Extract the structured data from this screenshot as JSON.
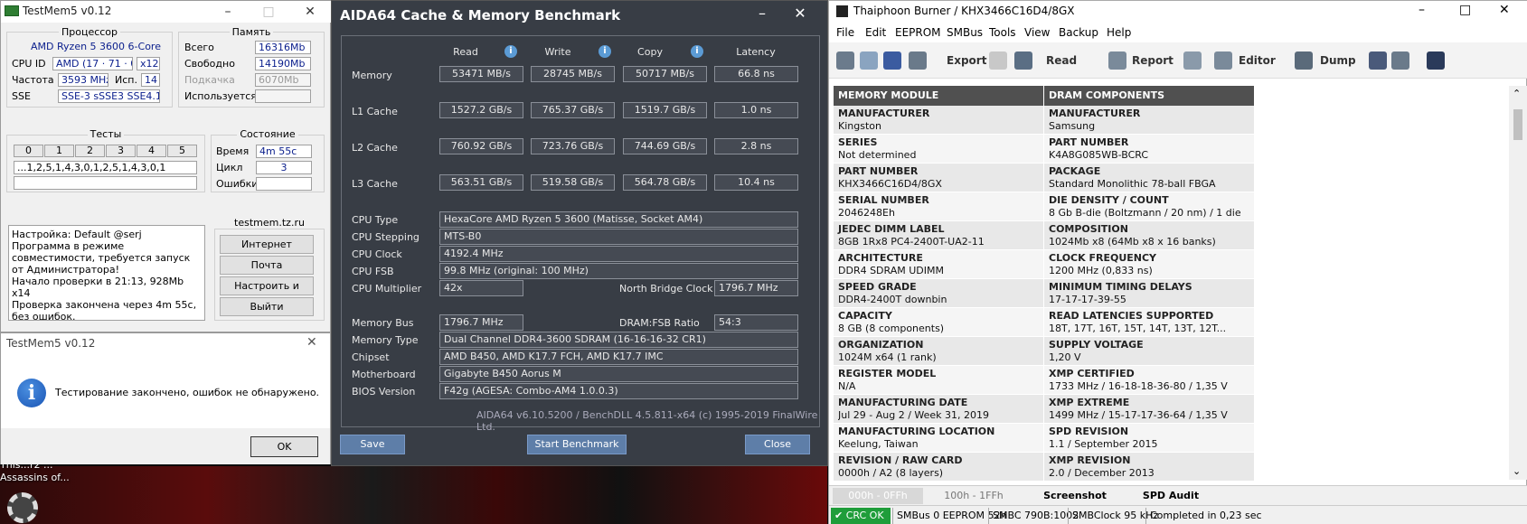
{
  "desktop": {
    "text_line1": "This...r2 ...",
    "text_line2": "Assassins of..."
  },
  "testmem": {
    "title": "TestMem5 v0.12",
    "cpu_group": "Процессор",
    "cpu_name": "AMD Ryzen 5 3600 6-Core",
    "cpu_id_label": "CPU ID",
    "cpu_id_value": "AMD  (17 · 71 · 0)",
    "cpu_threads": "x12",
    "freq_label": "Частота",
    "freq_value": "3593 MHz",
    "used_label": "Исп.",
    "used_value": "14",
    "sse_label": "SSE",
    "sse_value": "SSE-3 sSSE3 SSE4.1",
    "mem_group": "Память",
    "total_label": "Всего",
    "total_value": "16316Mb",
    "free_label": "Свободно",
    "free_value": "14190Mb",
    "swap_label": "Подкачка",
    "swap_value": "6070Mb",
    "inuse_label": "Используется",
    "inuse_value": "",
    "tests_group": "Тесты",
    "test_cells": [
      "0",
      "1",
      "2",
      "3",
      "4",
      "5"
    ],
    "test_sequence": "...1,2,5,1,4,3,0,1,2,5,1,4,3,0,1",
    "state_group": "Состояние",
    "time_label": "Время",
    "time_value": "4m 55c",
    "cycle_label": "Цикл",
    "cycle_value": "3",
    "errors_label": "Ошибки",
    "errors_value": "",
    "log_text": "Настройка: Default @serj\nПрограмма в режиме совместимости, требуется запуск от Администратора!\nНачало проверки в 21:13, 928Mb x14\nПроверка закончена через 4m 55c,\nбез ошибок.",
    "site_group": "testmem.tz.ru",
    "btn_internet": "Интернет",
    "btn_mail": "Почта",
    "btn_config": "Настроить и выйти",
    "btn_exit": "Выйти"
  },
  "dialog": {
    "title": "TestMem5 v0.12",
    "message": "Тестирование закончено, ошибок не обнаружено.",
    "ok_label": "OK"
  },
  "aida": {
    "title": "AIDA64 Cache & Memory Benchmark",
    "headers": {
      "read": "Read",
      "write": "Write",
      "copy": "Copy",
      "latency": "Latency"
    },
    "rows": [
      {
        "label": "Memory",
        "read": "53471 MB/s",
        "write": "28745 MB/s",
        "copy": "50717 MB/s",
        "latency": "66.8 ns"
      },
      {
        "label": "L1 Cache",
        "read": "1527.2 GB/s",
        "write": "765.37 GB/s",
        "copy": "1519.7 GB/s",
        "latency": "1.0 ns"
      },
      {
        "label": "L2 Cache",
        "read": "760.92 GB/s",
        "write": "723.76 GB/s",
        "copy": "744.69 GB/s",
        "latency": "2.8 ns"
      },
      {
        "label": "L3 Cache",
        "read": "563.51 GB/s",
        "write": "519.58 GB/s",
        "copy": "564.78 GB/s",
        "latency": "10.4 ns"
      }
    ],
    "cpu_type_label": "CPU Type",
    "cpu_type": "HexaCore AMD Ryzen 5 3600  (Matisse, Socket AM4)",
    "cpu_stepping_label": "CPU Stepping",
    "cpu_stepping": "MTS-B0",
    "cpu_clock_label": "CPU Clock",
    "cpu_clock": "4192.4 MHz",
    "cpu_fsb_label": "CPU FSB",
    "cpu_fsb": "99.8 MHz  (original: 100 MHz)",
    "cpu_mult_label": "CPU Multiplier",
    "cpu_mult": "42x",
    "nb_clock_label": "North Bridge Clock",
    "nb_clock": "1796.7 MHz",
    "mem_bus_label": "Memory Bus",
    "mem_bus": "1796.7 MHz",
    "dram_ratio_label": "DRAM:FSB Ratio",
    "dram_ratio": "54:3",
    "mem_type_label": "Memory Type",
    "mem_type": "Dual Channel DDR4-3600 SDRAM  (16-16-16-32 CR1)",
    "chipset_label": "Chipset",
    "chipset": "AMD B450, AMD K17.7 FCH, AMD K17.7 IMC",
    "mobo_label": "Motherboard",
    "mobo": "Gigabyte B450 Aorus M",
    "bios_label": "BIOS Version",
    "bios": "F42g  (AGESA: Combo-AM4 1.0.0.3)",
    "footer": "AIDA64 v6.10.5200 / BenchDLL 4.5.811-x64  (c) 1995-2019 FinalWire Ltd.",
    "btn_save": "Save",
    "btn_start": "Start Benchmark",
    "btn_close": "Close"
  },
  "thai": {
    "title": "Thaiphoon Burner / KHX3466C16D4/8GX",
    "menu": [
      "File",
      "Edit",
      "EEPROM",
      "SMBus",
      "Tools",
      "View",
      "Backup",
      "Help"
    ],
    "toolbar": {
      "export": "Export",
      "read": "Read",
      "report": "Report",
      "editor": "Editor",
      "dump": "Dump"
    },
    "left_header": "MEMORY MODULE",
    "right_header": "DRAM COMPONENTS",
    "left": [
      {
        "k": "MANUFACTURER",
        "v": "Kingston"
      },
      {
        "k": "SERIES",
        "v": "Not determined"
      },
      {
        "k": "PART NUMBER",
        "v": "KHX3466C16D4/8GX"
      },
      {
        "k": "SERIAL NUMBER",
        "v": "2046248Eh"
      },
      {
        "k": "JEDEC DIMM LABEL",
        "v": "8GB 1Rx8 PC4-2400T-UA2-11"
      },
      {
        "k": "ARCHITECTURE",
        "v": "DDR4 SDRAM UDIMM"
      },
      {
        "k": "SPEED GRADE",
        "v": "DDR4-2400T downbin"
      },
      {
        "k": "CAPACITY",
        "v": "8 GB (8 components)"
      },
      {
        "k": "ORGANIZATION",
        "v": "1024M x64 (1 rank)"
      },
      {
        "k": "REGISTER MODEL",
        "v": "N/A"
      },
      {
        "k": "MANUFACTURING DATE",
        "v": "Jul 29 - Aug 2 / Week 31, 2019"
      },
      {
        "k": "MANUFACTURING LOCATION",
        "v": "Keelung, Taiwan"
      },
      {
        "k": "REVISION / RAW CARD",
        "v": "0000h / A2 (8 layers)"
      }
    ],
    "right": [
      {
        "k": "MANUFACTURER",
        "v": "Samsung"
      },
      {
        "k": "PART NUMBER",
        "v": "K4A8G085WB-BCRC"
      },
      {
        "k": "PACKAGE",
        "v": "Standard Monolithic 78-ball FBGA"
      },
      {
        "k": "DIE DENSITY / COUNT",
        "v": "8 Gb B-die (Boltzmann / 20 nm) / 1 die"
      },
      {
        "k": "COMPOSITION",
        "v": "1024Mb x8 (64Mb x8 x 16 banks)"
      },
      {
        "k": "CLOCK FREQUENCY",
        "v": "1200 MHz (0,833 ns)"
      },
      {
        "k": "MINIMUM TIMING DELAYS",
        "v": "17-17-17-39-55"
      },
      {
        "k": "READ LATENCIES SUPPORTED",
        "v": "18T, 17T, 16T, 15T, 14T, 13T, 12T..."
      },
      {
        "k": "SUPPLY VOLTAGE",
        "v": "1,20 V"
      },
      {
        "k": "XMP CERTIFIED",
        "v": "1733 MHz / 16-18-18-36-80 / 1,35 V"
      },
      {
        "k": "XMP EXTREME",
        "v": "1499 MHz / 15-17-17-36-64 / 1,35 V"
      },
      {
        "k": "SPD REVISION",
        "v": "1.1 / September 2015"
      },
      {
        "k": "XMP REVISION",
        "v": "2.0 / December 2013"
      }
    ],
    "tab_range1": "000h - 0FFh",
    "tab_range2": "100h - 1FFh",
    "tab_screenshot": "Screenshot",
    "tab_spd_audit": "SPD Audit",
    "status_crc": "CRC OK",
    "status_smbus": "SMBus 0 EEPROM 52h",
    "status_smbc": "SMBC 790B:1002",
    "status_clock": "SMBClock 95 kHz",
    "status_done": "Completed in 0,23 sec"
  }
}
